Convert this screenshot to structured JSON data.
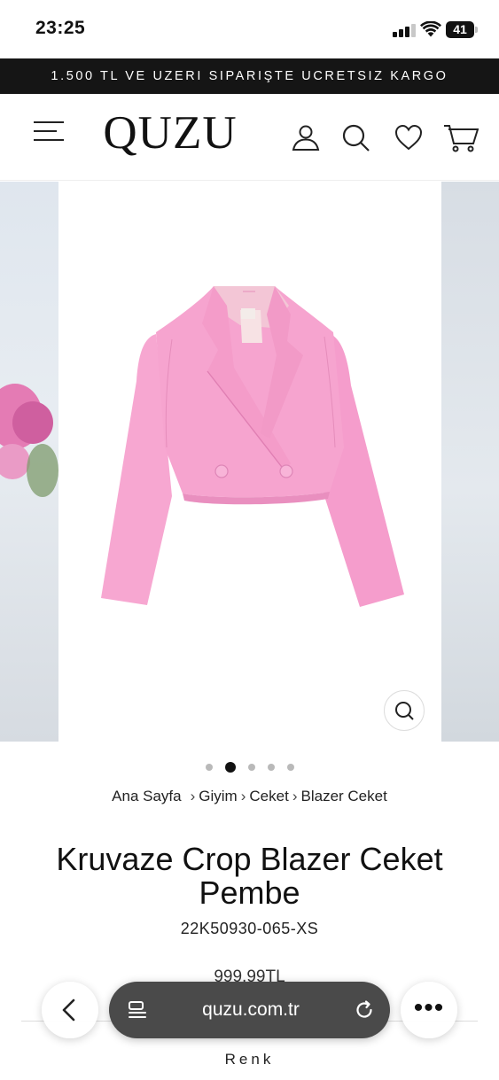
{
  "status_bar": {
    "time": "23:25",
    "battery": "41"
  },
  "promo": {
    "text": "1.500 TL VE UZERI SIPARIŞTE UCRETSIZ KARGO"
  },
  "header": {
    "logo": "QUZU",
    "icons": [
      "menu-icon",
      "user-icon",
      "search-icon",
      "heart-icon",
      "cart-icon"
    ]
  },
  "gallery": {
    "slide_count": 5,
    "active_slide": 2
  },
  "breadcrumb": {
    "items": [
      "Ana Sayfa",
      "Giyim",
      "Ceket",
      "Blazer Ceket"
    ]
  },
  "product": {
    "title": "Kruvaze Crop Blazer Ceket Pembe",
    "sku": "22K50930-065-XS",
    "price": "999,99TL",
    "color_label": "Renk"
  },
  "browser": {
    "url": "quzu.com.tr"
  },
  "colors": {
    "promo_bg": "#151515",
    "jacket_pink": "#f4a3cf",
    "url_bar": "#4a4a4a"
  }
}
